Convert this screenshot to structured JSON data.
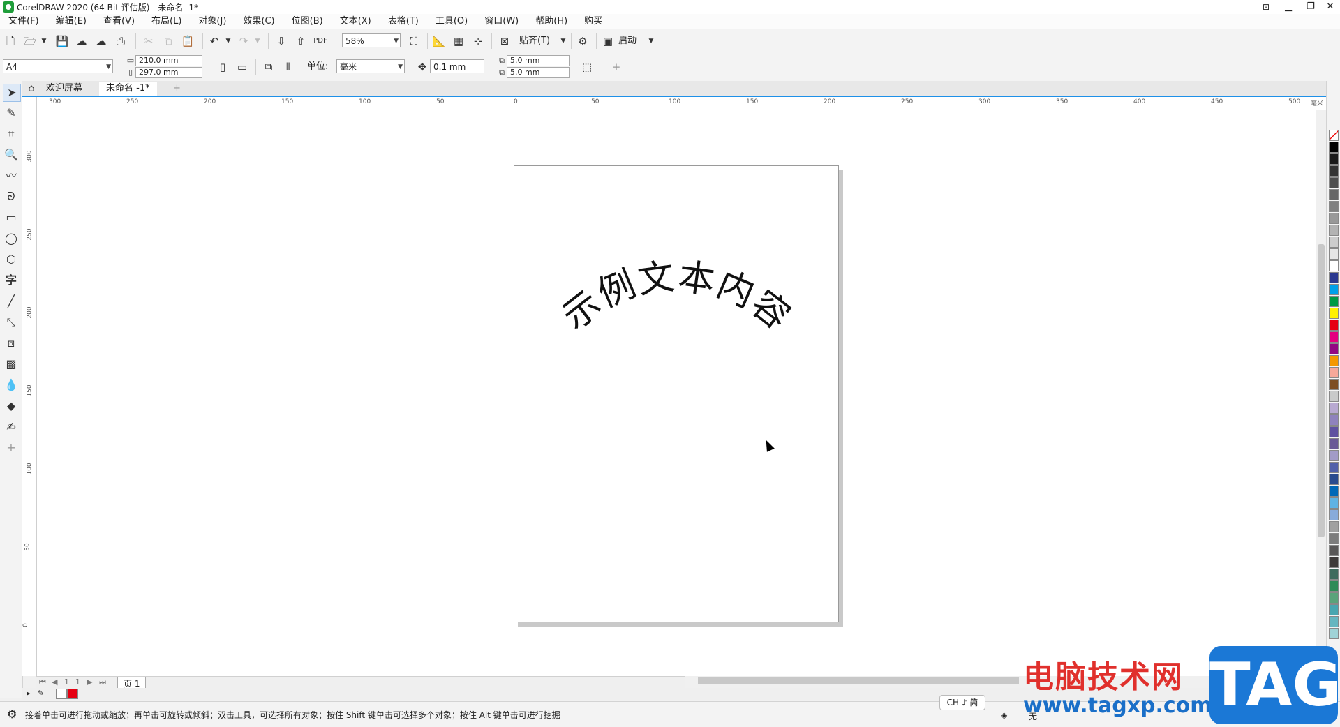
{
  "window": {
    "title": "CorelDRAW 2020 (64-Bit 评估版) - 未命名 -1*",
    "controls": [
      "▁",
      "❐",
      "✕"
    ]
  },
  "menu": [
    "文件(F)",
    "编辑(E)",
    "查看(V)",
    "布局(L)",
    "对象(J)",
    "效果(C)",
    "位图(B)",
    "文本(X)",
    "表格(T)",
    "工具(O)",
    "窗口(W)",
    "帮助(H)",
    "购买"
  ],
  "toolbar": {
    "zoom": "58%",
    "snap_label": "贴齐(T)",
    "launch_label": "启动"
  },
  "property_bar": {
    "page_size": "A4",
    "width": "210.0 mm",
    "height": "297.0 mm",
    "units_label": "单位:",
    "units_value": "毫米",
    "nudge": "0.1 mm",
    "dup_x": "5.0 mm",
    "dup_y": "5.0 mm"
  },
  "tabs": {
    "welcome": "欢迎屏幕",
    "document": "未命名 -1*",
    "add": "+"
  },
  "ruler": {
    "h_ticks": [
      "300",
      "250",
      "200",
      "150",
      "100",
      "50",
      "0",
      "50",
      "100",
      "150",
      "200",
      "250",
      "300",
      "350",
      "400",
      "450",
      "500"
    ],
    "h_unit": "毫米",
    "v_ticks": [
      "300",
      "250",
      "200",
      "150",
      "100",
      "50",
      "0"
    ]
  },
  "canvas": {
    "arc_text": [
      "示",
      "例",
      "文",
      "本",
      "内",
      "容"
    ]
  },
  "page_nav": {
    "current": "1",
    "of": "1",
    "page_tab": "页 1"
  },
  "status": {
    "hint": "接着单击可进行拖动或缩放；再单击可旋转或倾斜；双击工具，可选择所有对象；按住 Shift 键单击可选择多个对象；按住 Alt 键单击可进行挖掘",
    "ime": "CH ♪ 简",
    "fill": "无"
  },
  "watermark": {
    "site_name": "电脑技术网",
    "url": "www.tagxp.com",
    "badge": "TAG"
  },
  "palette_colors": [
    "#ffffff",
    "#000000",
    "#1a1a1a",
    "#333333",
    "#4d4d4d",
    "#666666",
    "#808080",
    "#999999",
    "#b3b3b3",
    "#cccccc",
    "#e6e6e6",
    "#ffffff",
    "#2b3990",
    "#00a0e9",
    "#009944",
    "#fff100",
    "#e60012",
    "#e4007f",
    "#920783",
    "#f39800",
    "#f5a89a",
    "#7d4e24",
    "#c9caca",
    "#b8a9d1",
    "#8f82bc",
    "#5f52a0",
    "#6a5a97",
    "#a29bc7",
    "#5161a9",
    "#2a4c8e",
    "#0068b7",
    "#5fb3e4",
    "#88abda",
    "#a0a0a0",
    "#7c7c7c",
    "#595757",
    "#3e3a39",
    "#3e6b5d",
    "#2e8b57",
    "#5aa37a",
    "#48a6b0",
    "#66b6c0",
    "#9fd3d7"
  ],
  "doc_palette": [
    "#ffffff",
    "#e60012"
  ]
}
